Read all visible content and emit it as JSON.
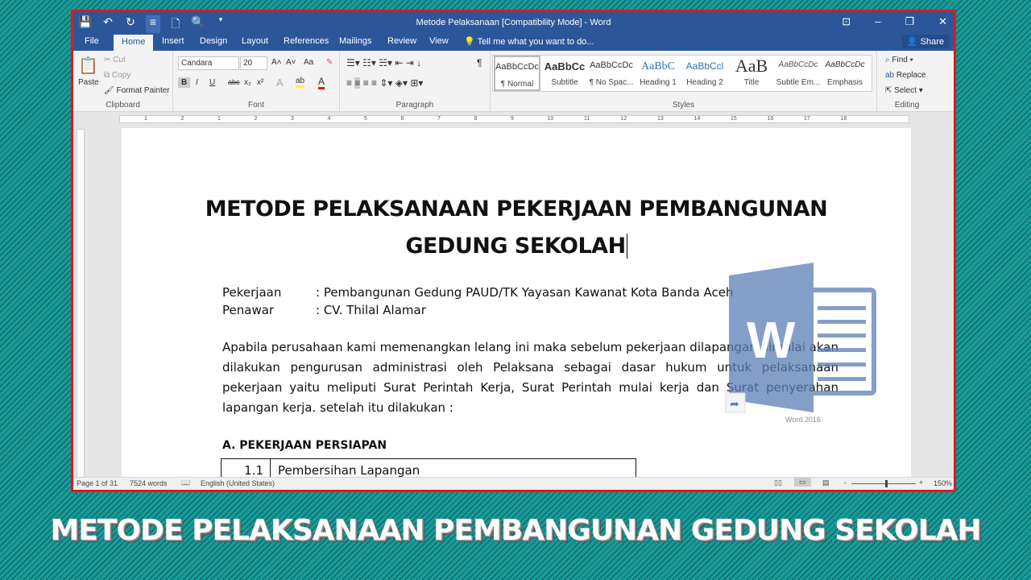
{
  "window": {
    "title": "Metode Pelaksanaan [Compatibility Mode] - Word",
    "min": "–",
    "restore": "❐",
    "close": "✕",
    "ribbon_display": "⊡"
  },
  "qat": [
    "💾",
    "↶",
    "↻",
    "≡",
    "🗋",
    "🔍",
    "▾"
  ],
  "tabs": [
    "File",
    "Home",
    "Insert",
    "Design",
    "Layout",
    "References",
    "Mailings",
    "Review",
    "View"
  ],
  "tell_me": "Tell me what you want to do...",
  "share": "Share",
  "clipboard": {
    "paste": "Paste",
    "cut": "Cut",
    "copy": "Copy",
    "format_painter": "Format Painter",
    "label": "Clipboard"
  },
  "font": {
    "name": "Candara",
    "size": "20",
    "label": "Font",
    "bold": "B",
    "italic": "I",
    "underline": "U",
    "strike": "abc",
    "sub": "x₂",
    "sup": "x²",
    "grow": "A˄",
    "shrink": "A˅",
    "case": "Aa",
    "color_highlight": "#ffff00",
    "color_font": "#e81123"
  },
  "paragraph": {
    "label": "Paragraph",
    "pilcrow": "¶"
  },
  "styles": {
    "label": "Styles",
    "items": [
      {
        "preview": "AaBbCcDc",
        "name": "¶ Normal"
      },
      {
        "preview": "AaBbCc",
        "name": "Subtitle"
      },
      {
        "preview": "AaBbCcDc",
        "name": "¶ No Spac..."
      },
      {
        "preview": "AaBbC",
        "name": "Heading 1"
      },
      {
        "preview": "AaBbCcl",
        "name": "Heading 2"
      },
      {
        "preview": "AaB",
        "name": "Title"
      },
      {
        "preview": "AaBbCcDc",
        "name": "Subtle Em..."
      },
      {
        "preview": "AaBbCcDc",
        "name": "Emphasis"
      }
    ]
  },
  "editing": {
    "find": "Find",
    "replace": "Replace",
    "select": "Select",
    "label": "Editing"
  },
  "ruler": [
    "1",
    "2",
    "1",
    "2",
    "3",
    "4",
    "5",
    "6",
    "7",
    "8",
    "9",
    "10",
    "11",
    "12",
    "13",
    "14",
    "15",
    "16",
    "17",
    "18"
  ],
  "document": {
    "title_line1": "METODE PELAKSANAAN PEKERJAAN PEMBANGUNAN",
    "title_line2": "GEDUNG SEKOLAH",
    "meta": [
      {
        "label": "Pekerjaan",
        "value": ": Pembangunan Gedung PAUD/TK Yayasan Kawanat Kota Banda Aceh"
      },
      {
        "label": "Penawar",
        "value": ": CV. Thilal Alamar"
      }
    ],
    "paragraph": "Apabila perusahaan kami memenangkan lelang ini maka sebelum pekerjaan dilapangan dimulai akan dilakukan pengurusan administrasi oleh Pelaksana sebagai dasar hukum untuk pelaksanaan pekerjaan yaitu meliputi Surat Perintah Kerja, Surat Perintah mulai kerja dan Surat penyerahan lapangan kerja. setelah itu dilakukan :",
    "section": "A. PEKERJAAN PERSIAPAN",
    "table": [
      {
        "no": "1.1",
        "item": "Pembersihan Lapangan"
      }
    ]
  },
  "overlay": {
    "logo_letter": "W",
    "logo_caption": "Word 2016",
    "logo_color": "#5b7fb5"
  },
  "status": {
    "page": "Page 1 of 31",
    "words": "7524 words",
    "language": "English (United States)",
    "zoom": "150%",
    "zoom_minus": "-",
    "zoom_plus": "+"
  },
  "caption": "METODE PELAKSANAAN PEMBANGUNAN GEDUNG SEKOLAH"
}
